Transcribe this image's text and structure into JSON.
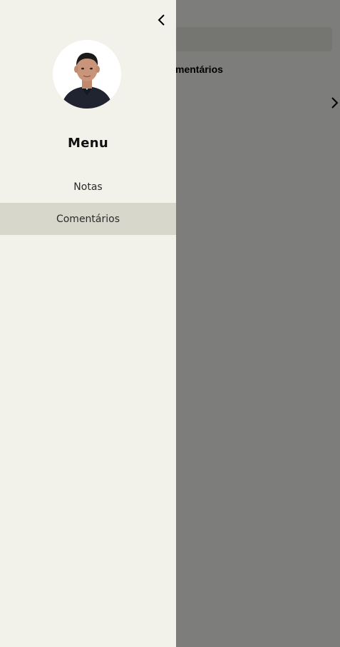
{
  "background": {
    "title_fragment": "mentários",
    "chevron_icon": "chevron-right-icon"
  },
  "drawer": {
    "close_icon": "chevron-left-icon",
    "avatar": "user-avatar",
    "title": "Menu",
    "items": [
      {
        "label": "Notas",
        "active": false
      },
      {
        "label": "Comentários",
        "active": true
      }
    ]
  },
  "colors": {
    "drawer_bg": "#f2f1ea",
    "active_item_bg": "#d8d7cb",
    "overlay": "rgba(0,0,0,0.5)"
  }
}
